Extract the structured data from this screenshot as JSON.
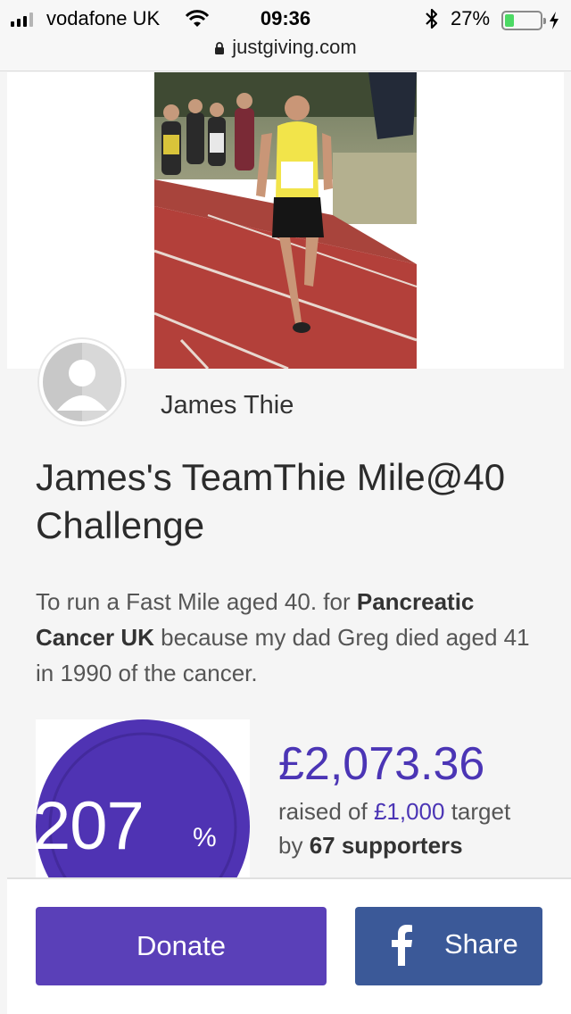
{
  "status_bar": {
    "carrier": "vodafone UK",
    "time": "09:36",
    "battery_percent": "27%",
    "battery_level": 0.27,
    "url": "justgiving.com"
  },
  "page": {
    "owner_name": "James Thie",
    "title": "James's TeamThie Mile@40 Challenge",
    "story_prefix": "To run a Fast Mile aged 40. for ",
    "story_charity": "Pancreatic Cancer UK",
    "story_suffix": " because my dad Greg died aged 41 in 1990 of the cancer."
  },
  "progress": {
    "percent_value": 207,
    "percent_label": "207",
    "percent_sign": "%",
    "amount_raised": "£2,073.36",
    "raised_prefix": "raised of ",
    "target": "£1,000",
    "raised_suffix": " target",
    "by_prefix": "by ",
    "supporters": "67 supporters"
  },
  "actions": {
    "donate_label": "Donate",
    "share_label": "Share"
  },
  "colors": {
    "brand_purple": "#5a40b8",
    "facebook_blue": "#3b5998",
    "battery_green": "#4cd964"
  },
  "icons": [
    "signal-icon",
    "wifi-icon",
    "bluetooth-icon",
    "battery-icon",
    "charging-bolt-icon",
    "lock-icon",
    "avatar-placeholder-icon",
    "facebook-icon"
  ]
}
